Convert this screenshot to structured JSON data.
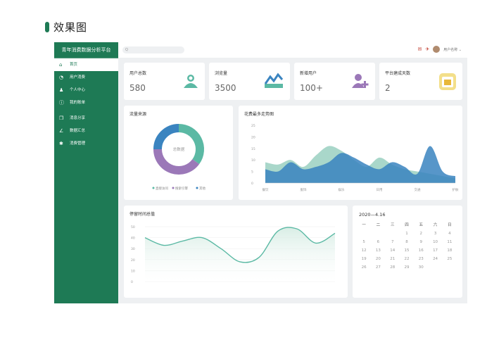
{
  "heading": "效果图",
  "colors": {
    "primary": "#1e7a55",
    "teal": "#5bb9a4",
    "purple": "#9b78b8",
    "blue": "#3a84c0"
  },
  "sidebar": {
    "title": "青年消费数据分析平台",
    "items": [
      {
        "label": "首页",
        "icon": "home-icon",
        "glyph": "⌂"
      },
      {
        "label": "用户消费",
        "icon": "chart-icon",
        "glyph": "◔"
      },
      {
        "label": "个人中心",
        "icon": "user-icon",
        "glyph": "♟"
      },
      {
        "label": "我的账单",
        "icon": "info-icon",
        "glyph": "ⓘ"
      },
      {
        "label": "消息分享",
        "icon": "share-icon",
        "glyph": "❐"
      },
      {
        "label": "数据汇总",
        "icon": "pen-icon",
        "glyph": "∠"
      },
      {
        "label": "消费管理",
        "icon": "settings-icon",
        "glyph": "✱"
      }
    ]
  },
  "topbar": {
    "search_placeholder": "Q",
    "username": "用户名称 ⌄"
  },
  "stats": [
    {
      "label": "用户总数",
      "value": "580",
      "icon": "user-icon"
    },
    {
      "label": "浏览量",
      "value": "3500",
      "icon": "trend-icon"
    },
    {
      "label": "新增用户",
      "value": "100+",
      "icon": "add-user-icon"
    },
    {
      "label": "平台建成天数",
      "value": "2",
      "icon": "calendar-icon"
    }
  ],
  "donut": {
    "title": "流量来源",
    "center_label": "总数据",
    "legend": [
      "直接访问",
      "搜索引擎",
      "其他"
    ]
  },
  "area_chart": {
    "title": "花费最多走势图",
    "yticks": [
      "25",
      "20",
      "15",
      "10",
      "5",
      "0"
    ],
    "xlabels": [
      "餐饮",
      "服饰",
      "娱乐",
      "日用",
      "交通",
      "护肤"
    ]
  },
  "line_chart": {
    "title": "停留时间总值",
    "yticks": [
      "50",
      "40",
      "30",
      "20",
      "10",
      "0"
    ]
  },
  "calendar": {
    "title": "2020—4.16",
    "weekdays": [
      "一",
      "二",
      "三",
      "四",
      "五",
      "六",
      "日"
    ],
    "days": [
      "",
      "",
      "",
      "1",
      "2",
      "3",
      "4",
      "5",
      "6",
      "7",
      "8",
      "9",
      "10",
      "11",
      "12",
      "13",
      "14",
      "15",
      "16",
      "17",
      "18",
      "19",
      "20",
      "21",
      "22",
      "23",
      "24",
      "25",
      "26",
      "27",
      "28",
      "29",
      "30"
    ]
  },
  "chart_data": [
    {
      "type": "pie",
      "title": "流量来源",
      "categories": [
        "直接访问",
        "搜索引擎",
        "其他"
      ],
      "values": [
        35,
        40,
        25
      ],
      "colors": [
        "#5bb9a4",
        "#9b78b8",
        "#3a84c0"
      ]
    },
    {
      "type": "area",
      "title": "花费最多走势图",
      "ylim": [
        0,
        25
      ],
      "x": [
        0,
        1,
        2,
        3,
        4,
        5,
        6,
        7,
        8,
        9,
        10,
        11,
        12,
        13,
        14,
        15
      ],
      "series": [
        {
          "values": [
            9,
            8,
            10,
            7,
            12,
            16,
            14,
            10,
            7,
            11,
            8,
            6,
            5,
            4,
            3,
            2
          ],
          "color": "#8cc9b8"
        },
        {
          "values": [
            6,
            5,
            9,
            6,
            7,
            9,
            13,
            11,
            8,
            6,
            9,
            7,
            4,
            16,
            5,
            3
          ],
          "color": "#3a84c0"
        }
      ]
    },
    {
      "type": "line",
      "title": "停留时间总值",
      "ylim": [
        0,
        50
      ],
      "x": [
        0,
        1,
        2,
        3,
        4,
        5,
        6,
        7,
        8,
        9,
        10
      ],
      "series": [
        {
          "values": [
            40,
            33,
            37,
            40,
            30,
            18,
            22,
            46,
            48,
            35,
            44
          ],
          "color": "#5bb9a4"
        }
      ]
    }
  ]
}
